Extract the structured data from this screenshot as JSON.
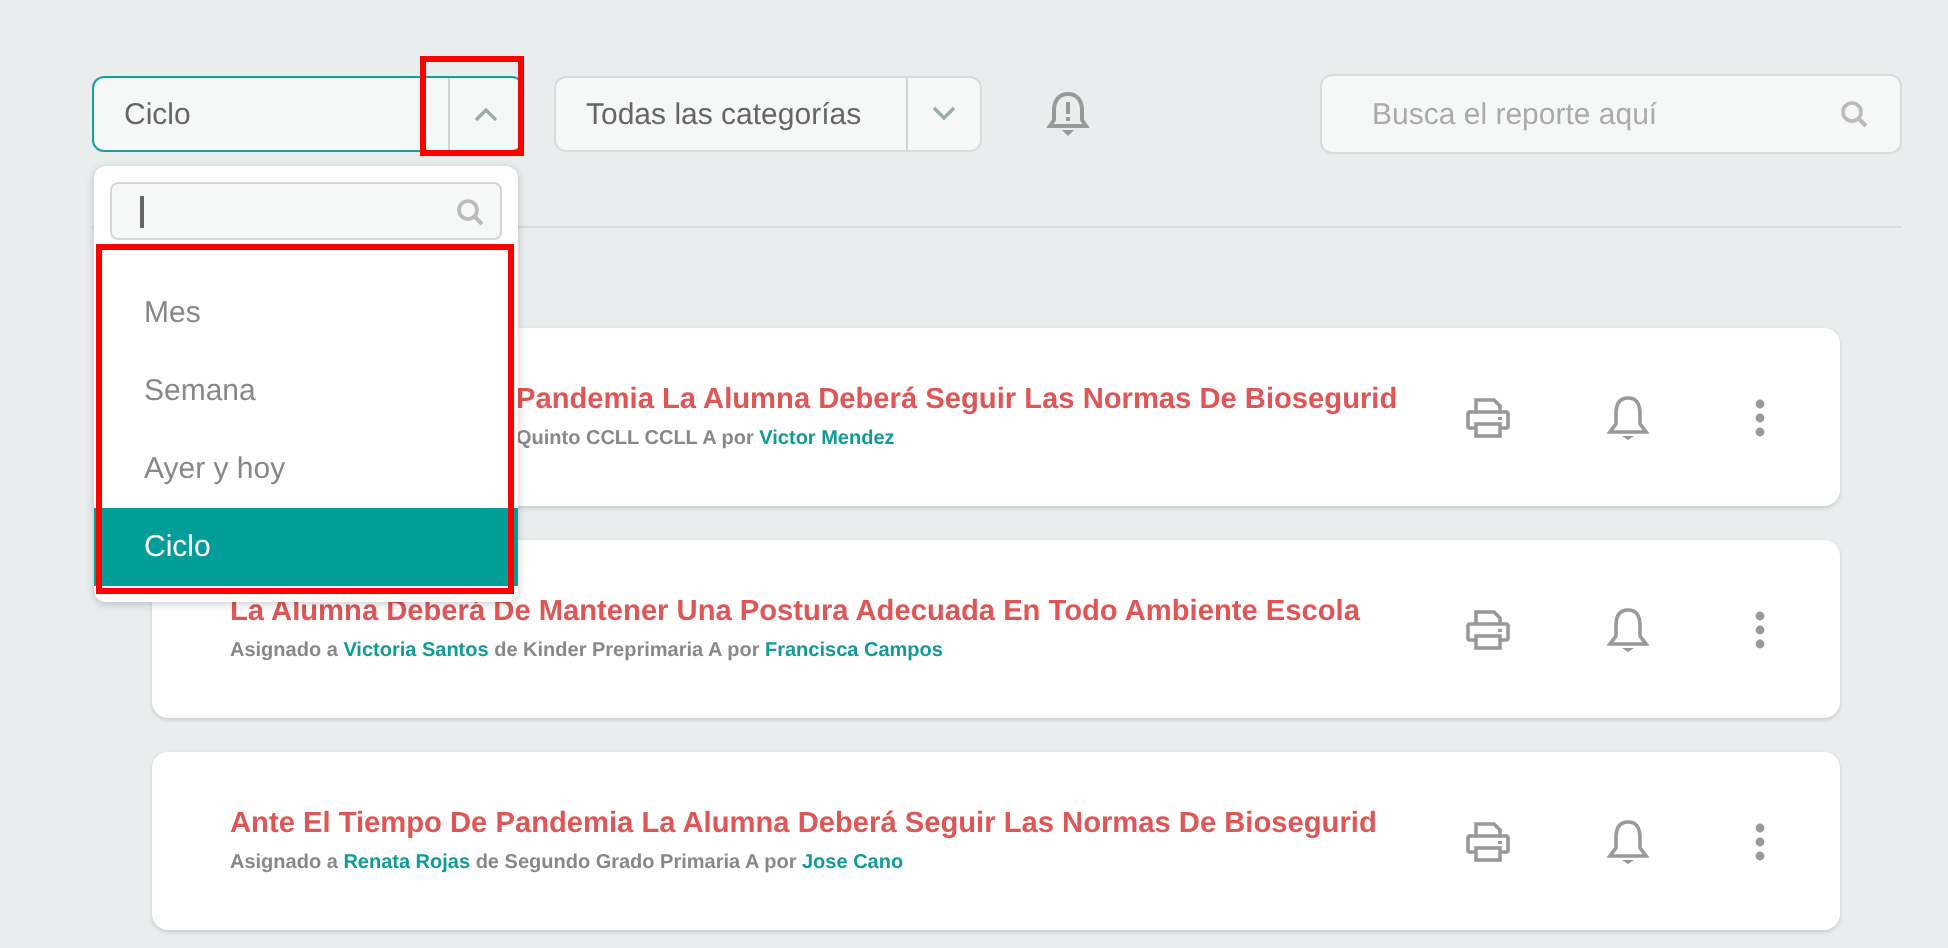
{
  "period_select": {
    "value": "Ciclo",
    "open": true,
    "options": [
      {
        "label": "Mes",
        "selected": false
      },
      {
        "label": "Semana",
        "selected": false
      },
      {
        "label": "Ayer y hoy",
        "selected": false
      },
      {
        "label": "Ciclo",
        "selected": true
      }
    ]
  },
  "category_select": {
    "value": "Todas las categorías",
    "open": false
  },
  "search": {
    "placeholder": "Busca el reporte aquí"
  },
  "reports": [
    {
      "title": "Pandemia La Alumna Deberá Seguir Las Normas De Biosegurid",
      "assignment": [
        {
          "kind": "plain",
          "text": "Quinto CCLL CCLL A por "
        },
        {
          "kind": "person",
          "text": "Victor Mendez"
        }
      ]
    },
    {
      "title": "La Alumna Deberá De Mantener Una Postura Adecuada En Todo Ambiente Escola",
      "assignment": [
        {
          "kind": "plain",
          "text": "Asignado a "
        },
        {
          "kind": "person",
          "text": "Victoria Santos"
        },
        {
          "kind": "plain",
          "text": " de Kinder Preprimaria A por "
        },
        {
          "kind": "person",
          "text": "Francisca Campos"
        }
      ]
    },
    {
      "title": "Ante El Tiempo De Pandemia La Alumna Deberá Seguir Las Normas De Biosegurid",
      "assignment": [
        {
          "kind": "plain",
          "text": "Asignado a "
        },
        {
          "kind": "person",
          "text": "Renata Rojas"
        },
        {
          "kind": "plain",
          "text": " de Segundo Grado Primaria A por "
        },
        {
          "kind": "person",
          "text": "Jose Cano"
        }
      ]
    }
  ]
}
